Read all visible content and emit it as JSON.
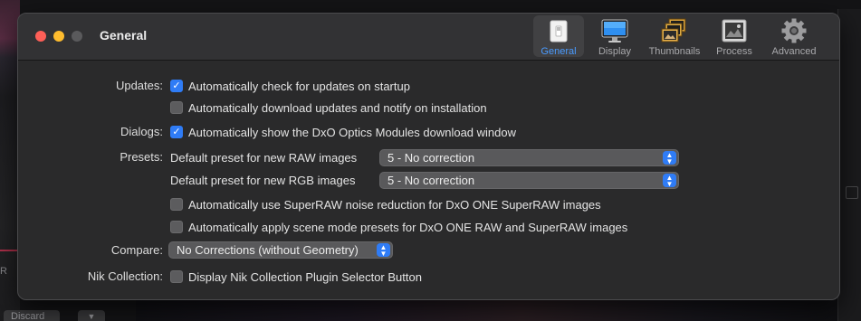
{
  "background": {
    "left_glyph": "R",
    "discard_label": "Discard",
    "dropdown_glyph": "▼"
  },
  "window": {
    "title": "General",
    "toolbar": [
      {
        "label": "General",
        "icon": "general-switch-icon",
        "active": true
      },
      {
        "label": "Display",
        "icon": "display-monitor-icon",
        "active": false
      },
      {
        "label": "Thumbnails",
        "icon": "thumbnails-icon",
        "active": false
      },
      {
        "label": "Process",
        "icon": "process-icon",
        "active": false
      },
      {
        "label": "Advanced",
        "icon": "gear-icon",
        "active": false
      }
    ]
  },
  "updates": {
    "label": "Updates:",
    "check_startup": {
      "text": "Automatically check for updates on startup",
      "checked": true
    },
    "auto_download": {
      "text": "Automatically download updates and notify on installation",
      "checked": false
    }
  },
  "dialogs": {
    "label": "Dialogs:",
    "show_download": {
      "text": "Automatically show the DxO Optics Modules download window",
      "checked": true
    }
  },
  "presets": {
    "label": "Presets:",
    "raw_label": "Default preset for new RAW images",
    "raw_value": "5 - No correction",
    "rgb_label": "Default preset for new RGB images",
    "rgb_value": "5 - No correction",
    "superraw_noise": {
      "text": "Automatically use SuperRAW noise reduction for DxO ONE SuperRAW images",
      "checked": false
    },
    "scene_mode": {
      "text": "Automatically apply scene mode presets for DxO ONE RAW and SuperRAW images",
      "checked": false
    }
  },
  "compare": {
    "label": "Compare:",
    "value": "No Corrections (without Geometry)"
  },
  "nik": {
    "label": "Nik Collection:",
    "display_selector": {
      "text": "Display Nik Collection Plugin Selector Button",
      "checked": false
    }
  },
  "colors": {
    "accent": "#2f7cf6",
    "active_tab_text": "#4a9bff",
    "window_bg": "#2a2a2b"
  }
}
